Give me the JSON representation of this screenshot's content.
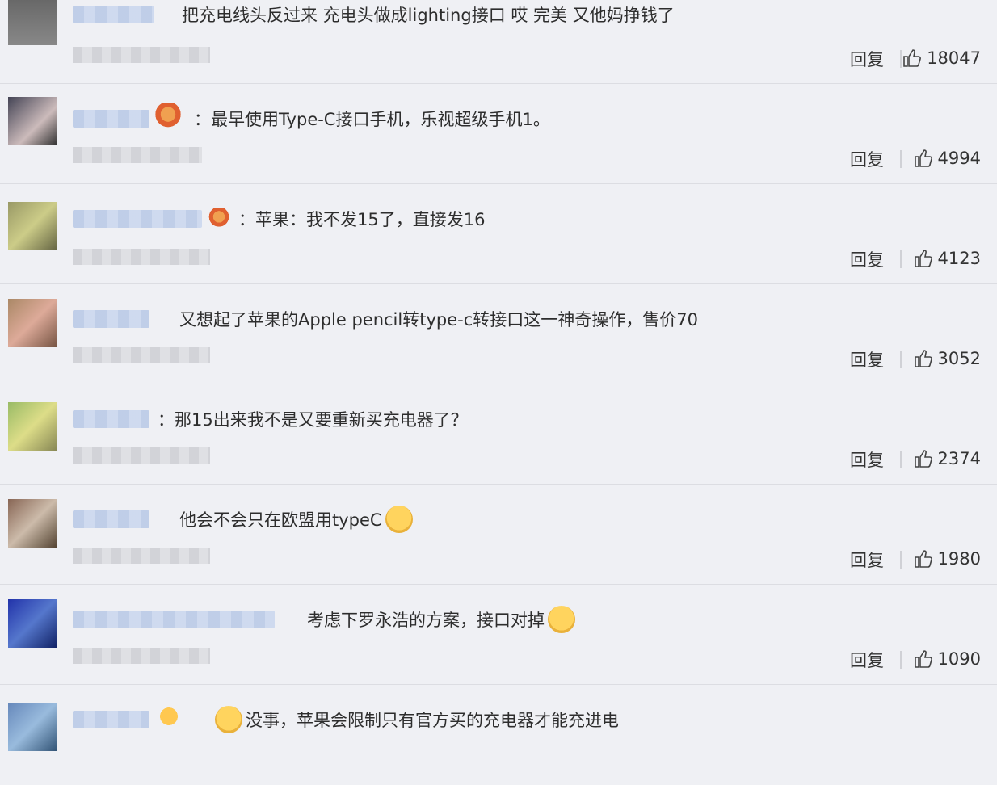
{
  "reply_label": "回复",
  "comments": [
    {
      "text": "把充电线头反过来 充电头做成lighting接口 哎 完美 又他妈挣钱了",
      "likes": "18047"
    },
    {
      "text": "：最早使用Type-C接口手机，乐视超级手机1。",
      "likes": "4994"
    },
    {
      "text": "：苹果：我不发15了，直接发16",
      "likes": "4123"
    },
    {
      "text": "又想起了苹果的Apple pencil转type-c转接口这一神奇操作，售价70",
      "likes": "3052"
    },
    {
      "text": "：那15出来我不是又要重新买充电器了？",
      "likes": "2374"
    },
    {
      "text": "他会不会只在欧盟用typeC",
      "likes": "1980"
    },
    {
      "text": "考虑下罗永浩的方案，接口对掉",
      "likes": "1090"
    },
    {
      "text": "没事，苹果会限制只有官方买的充电器才能充进电",
      "likes": ""
    }
  ]
}
